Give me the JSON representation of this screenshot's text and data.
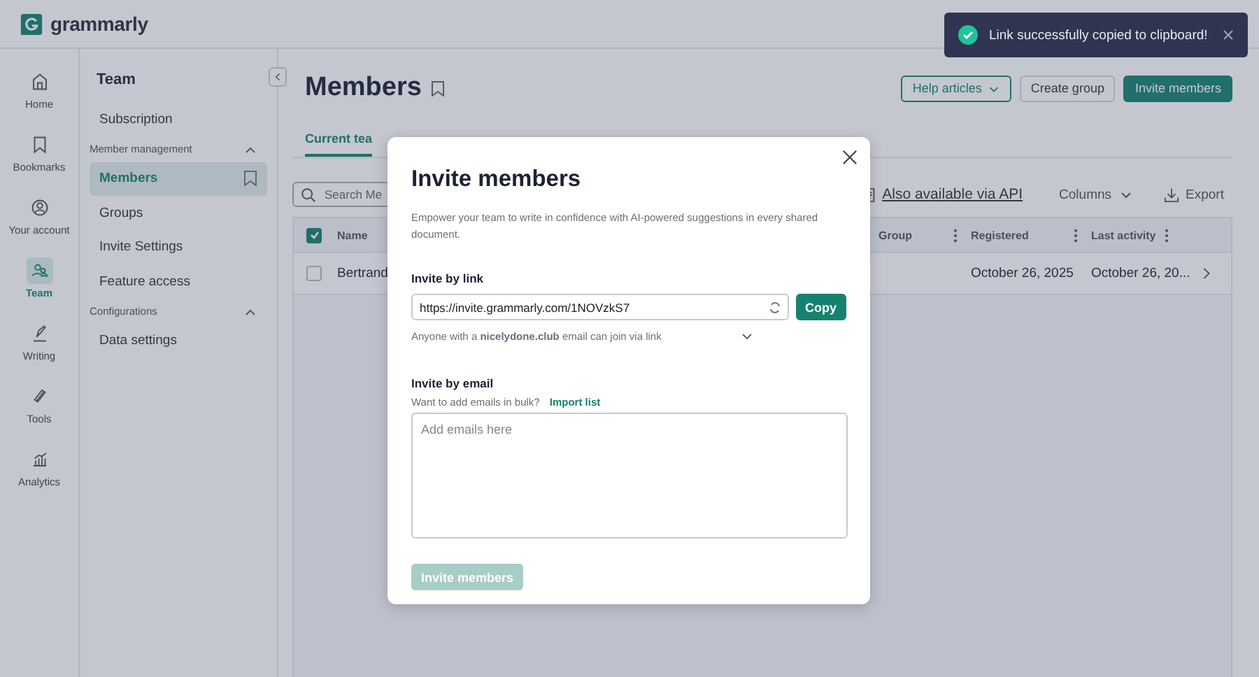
{
  "app": {
    "logo": "grammarly"
  },
  "rail": [
    {
      "label": "Home",
      "selected": false
    },
    {
      "label": "Bookmarks",
      "selected": false
    },
    {
      "label": "Your account",
      "selected": false
    },
    {
      "label": "Team",
      "selected": true
    },
    {
      "label": "Writing",
      "selected": false
    },
    {
      "label": "Tools",
      "selected": false
    },
    {
      "label": "Analytics",
      "selected": false
    }
  ],
  "sidebar": {
    "title": "Team",
    "items": [
      {
        "kind": "link",
        "label": "Subscription",
        "selected": false
      },
      {
        "kind": "section",
        "label": "Member management",
        "expanded": true
      },
      {
        "kind": "link",
        "label": "Members",
        "selected": true
      },
      {
        "kind": "link",
        "label": "Groups",
        "selected": false
      },
      {
        "kind": "link",
        "label": "Invite Settings",
        "selected": false
      },
      {
        "kind": "link",
        "label": "Feature access",
        "selected": false
      },
      {
        "kind": "section",
        "label": "Configurations",
        "expanded": true
      },
      {
        "kind": "link",
        "label": "Data settings",
        "selected": false
      }
    ]
  },
  "page": {
    "title": "Members",
    "buttons": [
      {
        "kind": "dropdown",
        "label": "Help articles"
      },
      {
        "kind": "outline",
        "label": "Create group"
      },
      {
        "kind": "primary",
        "label": "Invite members"
      }
    ],
    "tabs": [
      {
        "label": "Current tea",
        "selected": true
      }
    ]
  },
  "toolbar": {
    "search_placeholder": "Search Me",
    "api_link": "Also available via API",
    "columns": "Columns",
    "export": "Export"
  },
  "table": {
    "all_checked": true,
    "columns": [
      {
        "label": "Name"
      },
      {
        "label": "Group"
      },
      {
        "label": "Registered"
      },
      {
        "label": "Last activity"
      }
    ],
    "rows": [
      {
        "checked": false,
        "name": "Bertrand",
        "registered": "October 26, 2025",
        "last_activity": "October 26, 20..."
      }
    ]
  },
  "modal": {
    "title": "Invite members",
    "description": "Empower your team to write in confidence with AI-powered suggestions in every shared document.",
    "link_label": "Invite by link",
    "url": "https://invite.grammarly.com/1NOVzkS7",
    "copy": "Copy",
    "note": "Anyone with a **nicelydone.club** email can join via link",
    "email_label": "Invite by email",
    "email_hint": "Want to add emails in bulk?",
    "import": "Import list",
    "placeholder": "Add emails here",
    "submit": {
      "label": "Invite members",
      "disabled": true
    }
  },
  "toast": {
    "kind": "success",
    "message": "Link successfully copied to clipboard!"
  }
}
